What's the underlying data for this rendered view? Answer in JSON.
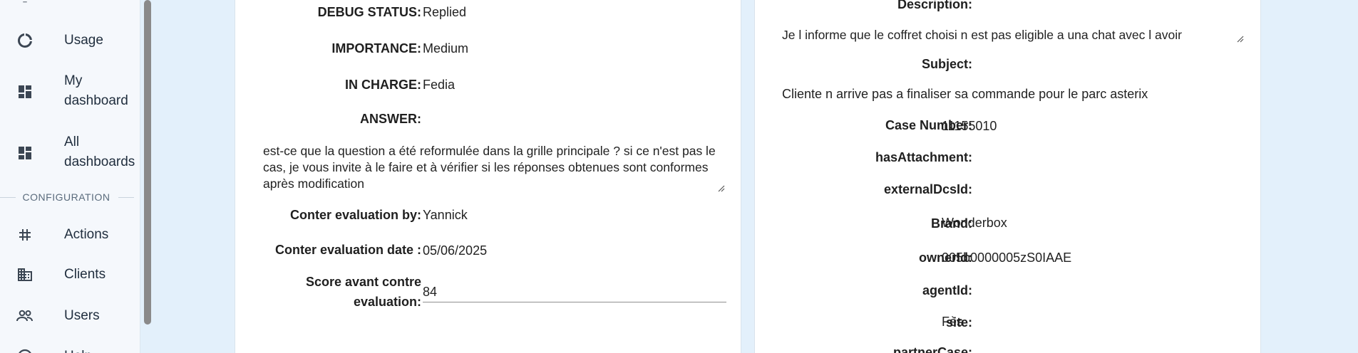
{
  "sidebar": {
    "top_item_partial": "Lizz",
    "items": [
      {
        "label": "Usage",
        "icon": "usage-icon"
      },
      {
        "label": "My dashboard",
        "label_lines": [
          "My",
          "dashboard"
        ],
        "icon": "dashboard-icon"
      },
      {
        "label": "All dashboards",
        "label_lines": [
          "All",
          "dashboards"
        ],
        "icon": "dashboard-icon"
      },
      {
        "label": "Actions",
        "icon": "grid-icon"
      },
      {
        "label": "Clients",
        "icon": "building-icon"
      },
      {
        "label": "Users",
        "icon": "users-icon"
      },
      {
        "label": "Help",
        "icon": "help-icon"
      }
    ],
    "section_configuration": "CONFIGURATION"
  },
  "left_card": {
    "debug_status": {
      "label": "DEBUG STATUS:",
      "value": "Replied"
    },
    "importance": {
      "label": "IMPORTANCE:",
      "value": "Medium"
    },
    "in_charge": {
      "label": "IN CHARGE:",
      "value": "Fedia"
    },
    "answer": {
      "label": "ANSWER:",
      "value": "est-ce que la question a été reformulée dans la grille principale ? si ce n'est pas le cas, je vous invite à le faire et à vérifier si les réponses obtenues sont conformes après modification"
    },
    "counter_by": {
      "label": "Conter evaluation by:",
      "value": "Yannick"
    },
    "counter_date": {
      "label": "Conter evaluation date :",
      "value": "05/06/2025"
    },
    "score": {
      "label_line1": "Score avant contre",
      "label_line2": "evaluation:",
      "value": "84"
    }
  },
  "right_card": {
    "description": {
      "label": "Description:",
      "value": "Je l informe que le coffret choisi n est pas eligible a una chat avec l avoir"
    },
    "subject": {
      "label": "Subject:",
      "value": "Cliente n arrive pas a finaliser sa commande pour le parc asterix"
    },
    "case_number": {
      "label": "Case Number:",
      "value": "11155010"
    },
    "has_attachment": {
      "label": "hasAttachment:",
      "value": ""
    },
    "external_dcs_id": {
      "label": "externalDcsId:",
      "value": ""
    },
    "brand": {
      "label": "Brand:",
      "value": "Wonderbox"
    },
    "owner_id": {
      "label": "ownerId:",
      "value": "005b0000005zS0IAAE"
    },
    "agent_id": {
      "label": "agentId:",
      "value": ""
    },
    "site": {
      "label": "site:",
      "value": "Fès"
    },
    "partner_case": {
      "label": "partnerCase:",
      "value": ""
    }
  }
}
